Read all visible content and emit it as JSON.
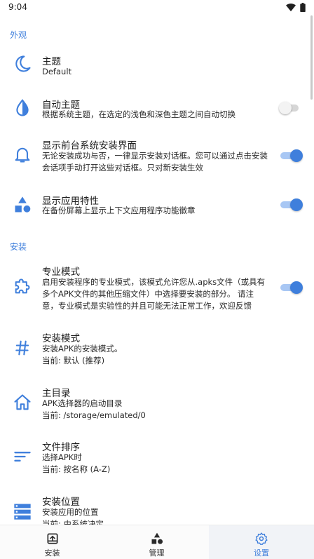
{
  "status": {
    "time": "9:04"
  },
  "colors": {
    "accent": "#3f7fdc",
    "toggle_track_on": "#a8c7f4",
    "toggle_off": "#d6d6d6"
  },
  "sections": {
    "appearance": "外观",
    "install": "安装"
  },
  "settings": {
    "theme": {
      "icon": "moon-icon",
      "title": "主题",
      "sub": "Default"
    },
    "auto_theme": {
      "icon": "contrast-drop-icon",
      "title": "自动主题",
      "sub": "根据系统主题，在选定的浅色和深色主题之间自动切换",
      "enabled": false
    },
    "foreground_install": {
      "icon": "bell-icon",
      "title": "显示前台系统安装界面",
      "sub": "无论安装成功与否，一律显示安装对话框。您可以通过点击安装会话项手动打开这些对话框。只对新安装生效",
      "enabled": true
    },
    "app_features": {
      "icon": "shapes-icon",
      "title": "显示应用特性",
      "sub": "在备份屏幕上显示上下文应用程序功能徽章",
      "enabled": true
    },
    "pro_mode": {
      "icon": "puzzle-icon",
      "title": "专业模式",
      "sub": "启用安装程序的专业模式，该模式允许您从.apks文件（或具有多个APK文件的其他压缩文件）中选择要安装的部分。 请注意，专业模式是实验性的并且可能无法正常工作，欢迎反馈",
      "enabled": true
    },
    "install_mode": {
      "icon": "hash-icon",
      "title": "安装模式",
      "sub": "安装APK的安装模式。",
      "current": "当前: 默认 (推荐)"
    },
    "home_dir": {
      "icon": "home-icon",
      "title": "主目录",
      "sub": "APK选择器的启动目录",
      "current": "当前: /storage/emulated/0"
    },
    "file_sort": {
      "icon": "sort-icon",
      "title": "文件排序",
      "sub": "选择APK时",
      "current": "当前: 按名称 (A-Z)"
    },
    "install_location": {
      "icon": "storage-icon",
      "title": "安装位置",
      "sub": "安装应用的位置",
      "current": "当前: 由系统决定"
    }
  },
  "nav": {
    "install": {
      "icon": "install-icon",
      "label": "安装"
    },
    "manage": {
      "icon": "shapes-icon",
      "label": "管理"
    },
    "settings": {
      "icon": "gear-icon",
      "label": "设置",
      "active": true
    }
  }
}
